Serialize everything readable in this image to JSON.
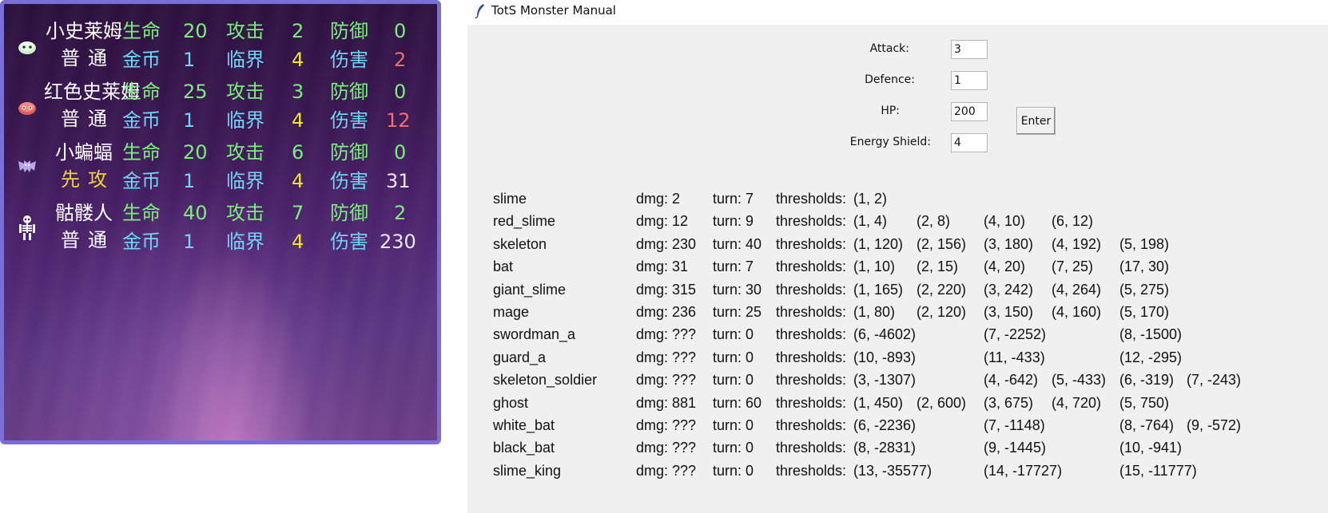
{
  "game_panel": {
    "labels": {
      "hp": "生命",
      "atk": "攻击",
      "def": "防御",
      "gold": "金币",
      "crit": "临界",
      "dmg": "伤害"
    },
    "monsters": [
      {
        "name": "小史莱姆",
        "type": "普通",
        "icon": "green-slime-icon",
        "hp": "20",
        "atk": "2",
        "def": "0",
        "gold": "1",
        "crit": "4",
        "dmg": "2",
        "dmg_color": "#f07070"
      },
      {
        "name": "红色史莱姆",
        "type": "普通",
        "icon": "red-slime-icon",
        "hp": "25",
        "atk": "3",
        "def": "0",
        "gold": "1",
        "crit": "4",
        "dmg": "12",
        "dmg_color": "#f07070"
      },
      {
        "name": "小蝙蝠",
        "type": "先攻",
        "icon": "bat-icon",
        "hp": "20",
        "atk": "6",
        "def": "0",
        "gold": "1",
        "crit": "4",
        "dmg": "31",
        "dmg_color": "#e8e8e8"
      },
      {
        "name": "骷髅人",
        "type": "普通",
        "icon": "skeleton-icon",
        "hp": "40",
        "atk": "7",
        "def": "2",
        "gold": "1",
        "crit": "4",
        "dmg": "230",
        "dmg_color": "#e8e8e8"
      }
    ]
  },
  "window": {
    "title": "TotS Monster Manual",
    "form": {
      "attack_label": "Attack:",
      "attack_value": "3",
      "defence_label": "Defence:",
      "defence_value": "1",
      "hp_label": "HP:",
      "hp_value": "200",
      "shield_label": "Energy Shield:",
      "shield_value": "4",
      "enter_label": "Enter"
    },
    "monsters": [
      {
        "name": "slime",
        "dmg": "dmg: 2",
        "turn": "turn: 7",
        "thr_label": "thresholds:",
        "thresholds": [
          [
            "(1, 2)",
            0
          ]
        ]
      },
      {
        "name": "red_slime",
        "dmg": "dmg: 12",
        "turn": "turn: 9",
        "thr_label": "thresholds:",
        "thresholds": [
          [
            "(1, 4)",
            0
          ],
          [
            "(2, 8)",
            1
          ],
          [
            "(4, 10)",
            2
          ],
          [
            "(6, 12)",
            3
          ]
        ]
      },
      {
        "name": "skeleton",
        "dmg": "dmg: 230",
        "turn": "turn: 40",
        "thr_label": "thresholds:",
        "thresholds": [
          [
            "(1, 120)",
            0
          ],
          [
            "(2, 156)",
            1
          ],
          [
            "(3, 180)",
            2
          ],
          [
            "(4, 192)",
            3
          ],
          [
            "(5, 198)",
            4
          ]
        ]
      },
      {
        "name": "bat",
        "dmg": "dmg: 31",
        "turn": "turn: 7",
        "thr_label": "thresholds:",
        "thresholds": [
          [
            "(1, 10)",
            0
          ],
          [
            "(2, 15)",
            1
          ],
          [
            "(4, 20)",
            2
          ],
          [
            "(7, 25)",
            3
          ],
          [
            "(17, 30)",
            4
          ]
        ]
      },
      {
        "name": "giant_slime",
        "dmg": "dmg: 315",
        "turn": "turn: 30",
        "thr_label": "thresholds:",
        "thresholds": [
          [
            "(1, 165)",
            0
          ],
          [
            "(2, 220)",
            1
          ],
          [
            "(3, 242)",
            2
          ],
          [
            "(4, 264)",
            3
          ],
          [
            "(5, 275)",
            4
          ]
        ]
      },
      {
        "name": "mage",
        "dmg": "dmg: 236",
        "turn": "turn: 25",
        "thr_label": "thresholds:",
        "thresholds": [
          [
            "(1, 80)",
            0
          ],
          [
            "(2, 120)",
            1
          ],
          [
            "(3, 150)",
            2
          ],
          [
            "(4, 160)",
            3
          ],
          [
            "(5, 170)",
            4
          ]
        ]
      },
      {
        "name": "swordman_a",
        "dmg": "dmg: ???",
        "turn": "turn: 0",
        "thr_label": "thresholds:",
        "thresholds": [
          [
            "(6, -4602)",
            0
          ],
          [
            "(7, -2252)",
            2
          ],
          [
            "(8, -1500)",
            4
          ]
        ]
      },
      {
        "name": "guard_a",
        "dmg": "dmg: ???",
        "turn": "turn: 0",
        "thr_label": "thresholds:",
        "thresholds": [
          [
            "(10, -893)",
            0
          ],
          [
            "(11, -433)",
            2
          ],
          [
            "(12, -295)",
            4
          ]
        ]
      },
      {
        "name": "skeleton_soldier",
        "dmg": "dmg: ???",
        "turn": "turn: 0",
        "thr_label": "thresholds:",
        "thresholds": [
          [
            "(3, -1307)",
            0
          ],
          [
            "(4, -642)",
            2
          ],
          [
            "(5, -433)",
            3
          ],
          [
            "(6, -319)",
            4
          ],
          [
            "(7, -243)",
            5
          ]
        ]
      },
      {
        "name": "ghost",
        "dmg": "dmg: 881",
        "turn": "turn: 60",
        "thr_label": "thresholds:",
        "thresholds": [
          [
            "(1, 450)",
            0
          ],
          [
            "(2, 600)",
            1
          ],
          [
            "(3, 675)",
            2
          ],
          [
            "(4, 720)",
            3
          ],
          [
            "(5, 750)",
            4
          ]
        ]
      },
      {
        "name": "white_bat",
        "dmg": "dmg: ???",
        "turn": "turn: 0",
        "thr_label": "thresholds:",
        "thresholds": [
          [
            "(6, -2236)",
            0
          ],
          [
            "(7, -1148)",
            2
          ],
          [
            "(8, -764)",
            4
          ],
          [
            "(9, -572)",
            5
          ]
        ]
      },
      {
        "name": "black_bat",
        "dmg": "dmg: ???",
        "turn": "turn: 0",
        "thr_label": "thresholds:",
        "thresholds": [
          [
            "(8, -2831)",
            0
          ],
          [
            "(9, -1445)",
            2
          ],
          [
            "(10, -941)",
            4
          ]
        ]
      },
      {
        "name": "slime_king",
        "dmg": "dmg: ???",
        "turn": "turn: 0",
        "thr_label": "thresholds:",
        "thresholds": [
          [
            "(13, -35577)",
            0
          ],
          [
            "(14, -17727)",
            2
          ],
          [
            "(15, -11777)",
            4
          ]
        ]
      }
    ]
  }
}
